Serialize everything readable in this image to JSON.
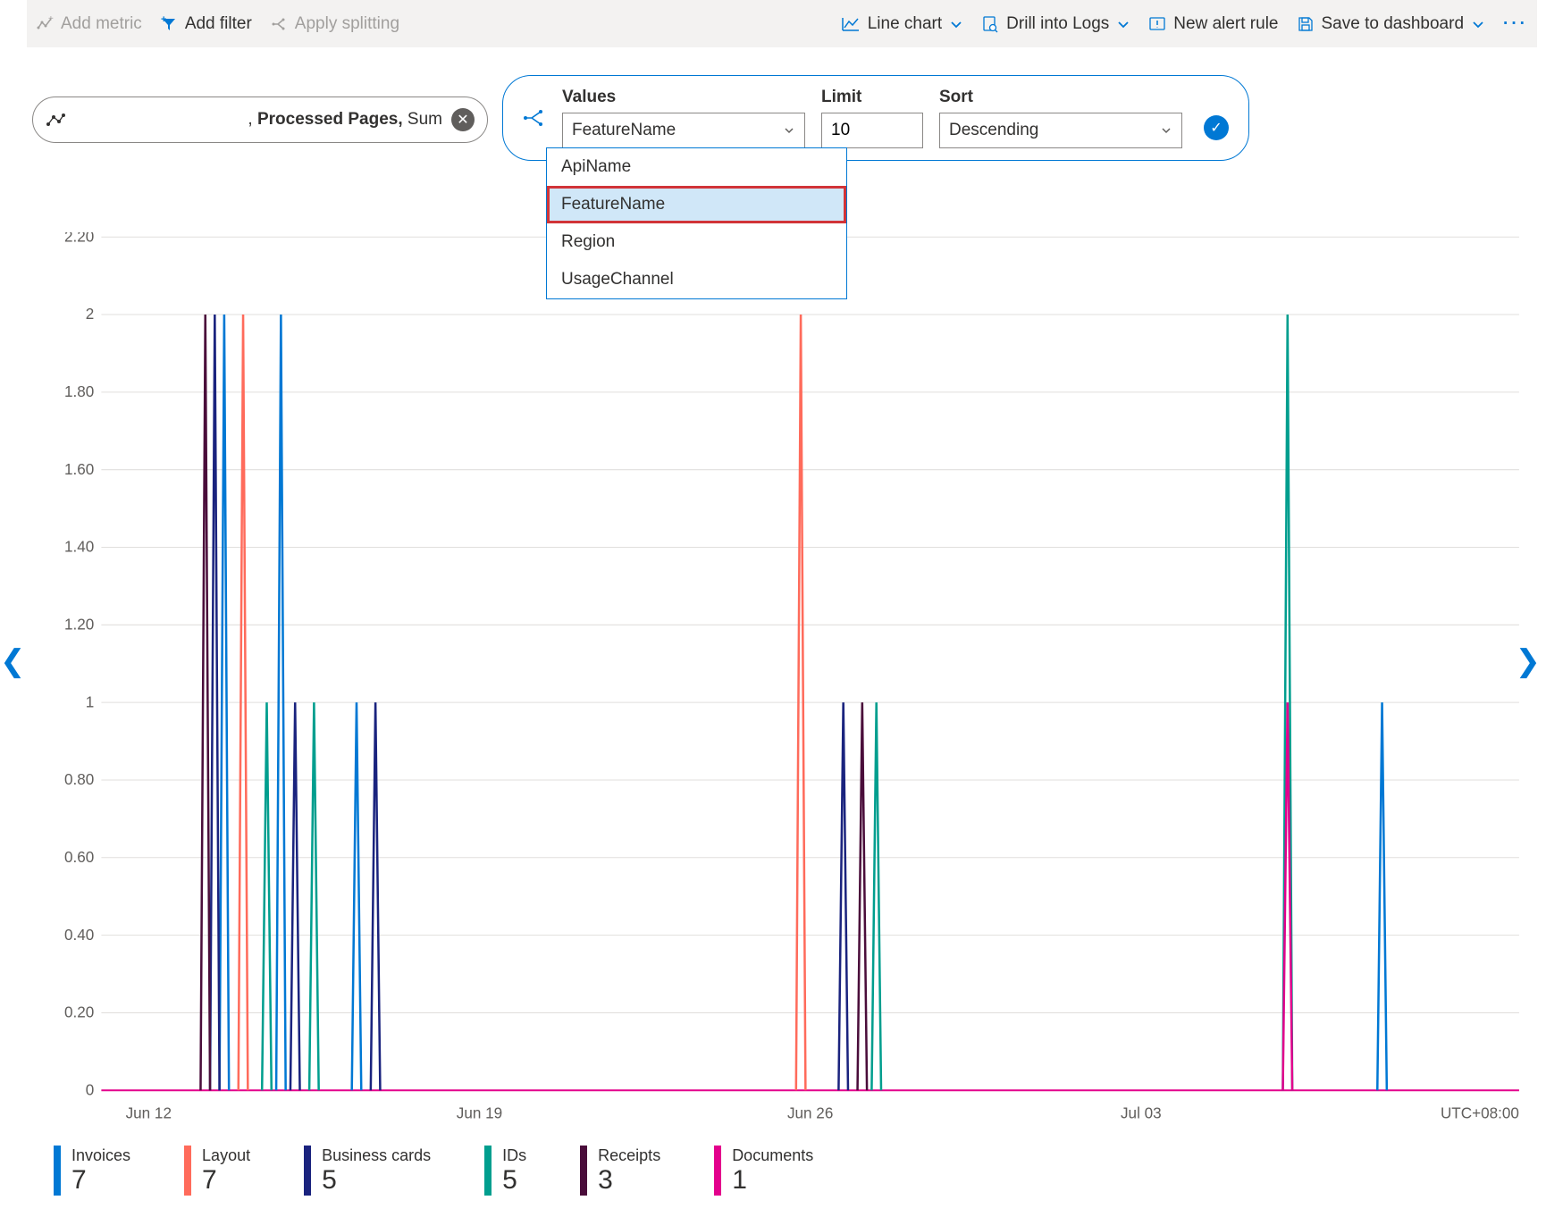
{
  "toolbar": {
    "add_metric": "Add metric",
    "add_filter": "Add filter",
    "apply_splitting": "Apply splitting",
    "line_chart": "Line chart",
    "drill_logs": "Drill into Logs",
    "new_alert": "New alert rule",
    "save_dash": "Save to dashboard"
  },
  "metric_pill": {
    "text": ", Processed Pages, Sum",
    "bold_part": "Processed Pages,"
  },
  "split": {
    "values_label": "Values",
    "values_value": "FeatureName",
    "limit_label": "Limit",
    "limit_value": "10",
    "sort_label": "Sort",
    "sort_value": "Descending"
  },
  "dropdown": {
    "items": [
      "ApiName",
      "FeatureName",
      "Region",
      "UsageChannel"
    ],
    "selected": "FeatureName"
  },
  "chart_data": {
    "type": "line",
    "ylim": [
      0,
      2.2
    ],
    "y_ticks": [
      "2.20",
      "2",
      "1.80",
      "1.60",
      "1.40",
      "1.20",
      "1",
      "0.80",
      "0.60",
      "0.40",
      "0.20",
      "0"
    ],
    "x_ticks": [
      "Jun 12",
      "Jun 19",
      "Jun 26",
      "Jul 03"
    ],
    "tz": "UTC+08:00",
    "series": [
      {
        "name": "Invoices",
        "color": "#0078d4",
        "total": 7,
        "x": [
          2.5,
          2.6,
          2.7,
          3.7,
          3.8,
          3.9,
          5.3,
          5.4,
          5.5,
          27.0,
          27.1,
          27.2
        ],
        "y": [
          0,
          2,
          0,
          0,
          2,
          0,
          0,
          1,
          0,
          0,
          1,
          0
        ]
      },
      {
        "name": "Layout",
        "color": "#ff6b5b",
        "total": 7,
        "x": [
          2.9,
          3.0,
          3.1,
          14.7,
          14.8,
          14.9
        ],
        "y": [
          0,
          2,
          0,
          0,
          2,
          0
        ]
      },
      {
        "name": "Business cards",
        "color": "#1a237e",
        "total": 5,
        "x": [
          2.3,
          2.4,
          2.5,
          4.0,
          4.1,
          4.2,
          5.7,
          5.8,
          5.9,
          15.6,
          15.7,
          15.8
        ],
        "y": [
          0,
          2,
          0,
          0,
          1,
          0,
          0,
          1,
          0,
          0,
          1,
          0
        ]
      },
      {
        "name": "IDs",
        "color": "#009e8e",
        "total": 5,
        "x": [
          3.4,
          3.5,
          3.6,
          4.4,
          4.5,
          4.6,
          16.3,
          16.4,
          16.5,
          25.0,
          25.1,
          25.2
        ],
        "y": [
          0,
          1,
          0,
          0,
          1,
          0,
          0,
          1,
          0,
          0,
          2,
          0
        ]
      },
      {
        "name": "Receipts",
        "color": "#4a0d3a",
        "total": 3,
        "x": [
          2.1,
          2.2,
          2.3,
          16.0,
          16.1,
          16.2
        ],
        "y": [
          0,
          2,
          0,
          0,
          1,
          0
        ]
      },
      {
        "name": "Documents",
        "color": "#e3008c",
        "total": 1,
        "x": [
          25.0,
          25.1,
          25.2
        ],
        "y": [
          0,
          1,
          0
        ]
      }
    ]
  }
}
